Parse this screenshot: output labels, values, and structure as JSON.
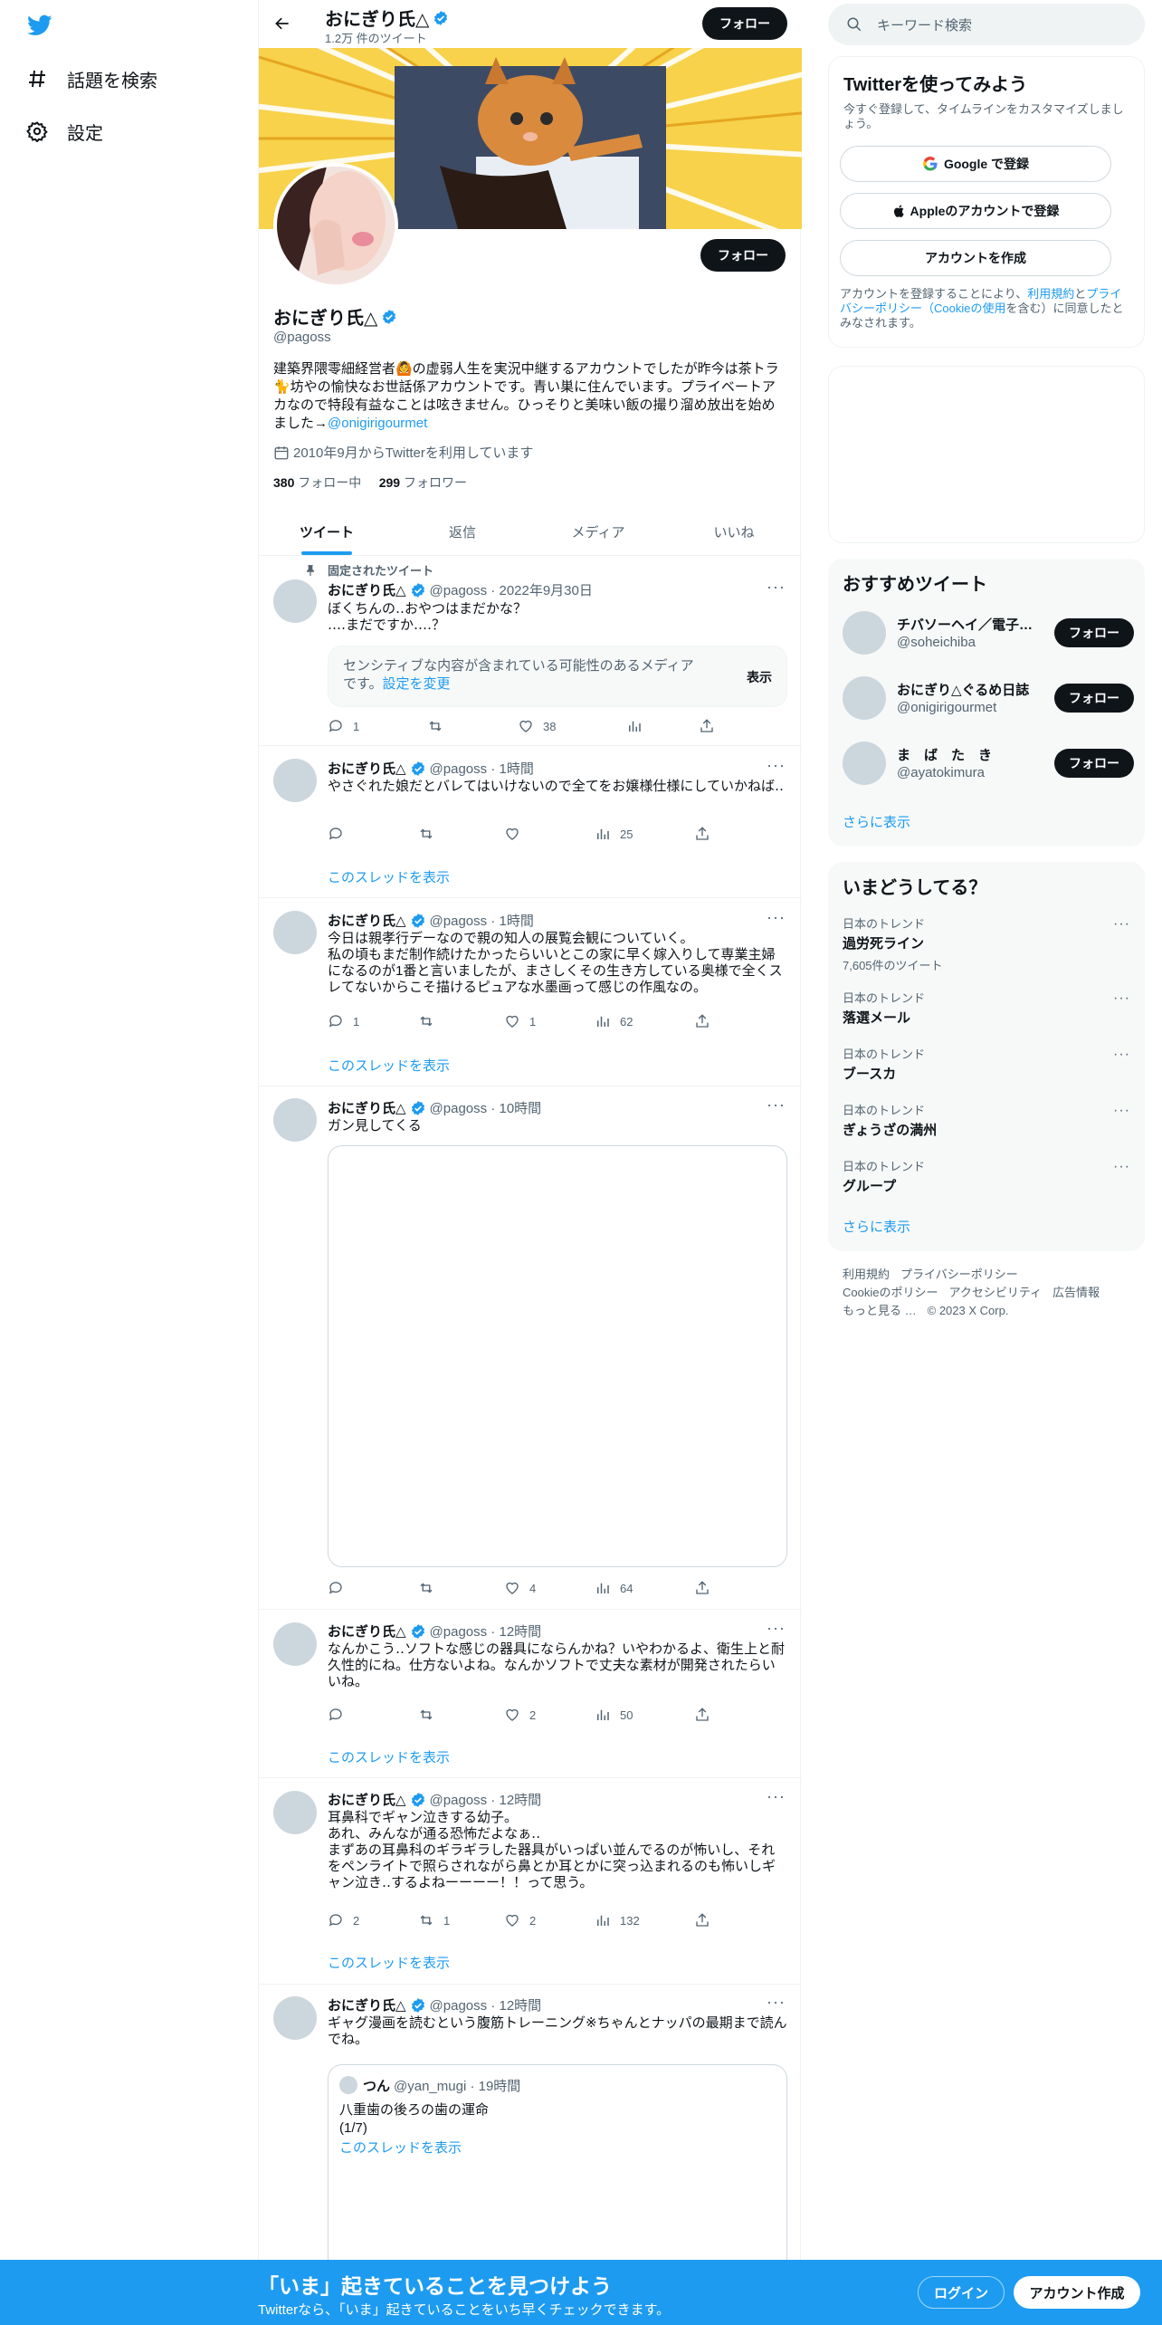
{
  "nav": {
    "explore_label": "話題を検索",
    "settings_label": "設定"
  },
  "header": {
    "name": "おにぎり氏△",
    "tweet_count": "1.2万 件のツイート",
    "follow_label": "フォロー"
  },
  "profile": {
    "name": "おにぎり氏△",
    "handle": "@pagoss",
    "bio": "建築界隈零細経営者🙆の虚弱人生を実況中継するアカウントでしたが昨今は茶トラ🐈坊やの愉快なお世話係アカウントです。青い巣に住んでいます。プライベートアカなので特段有益なことは呟きません。ひっそりと美味い飯の撮り溜め放出を始めました→",
    "bio_link": "@onigirigourmet",
    "joined": "2010年9月からTwitterを利用しています",
    "following_count": "380",
    "following_label": "フォロー中",
    "followers_count": "299",
    "followers_label": "フォロワー",
    "follow_label": "フォロー"
  },
  "tabs": [
    "ツイート",
    "返信",
    "メディア",
    "いいね"
  ],
  "pinned_label": "固定されたツイート",
  "thread_link_label": "このスレッドを表示",
  "tweets": [
    {
      "name": "おにぎり氏△",
      "meta": "@pagoss · 2022年9月30日",
      "text": "ぼくちんの‥おやつはまだかな？\n‥‥まだですか‥‥？",
      "sensitive_text": "センシティブな内容が含まれている可能性のあるメディアです。",
      "sensitive_link": "設定を変更",
      "sensitive_button": "表示",
      "replies": "1",
      "retweets": "",
      "likes": "38",
      "views": ""
    },
    {
      "name": "おにぎり氏△",
      "meta": "@pagoss · 1時間",
      "text": "やさぐれた娘だとバレてはいけないので全てをお嬢様仕様にしていかねば‥",
      "replies": "",
      "retweets": "",
      "likes": "",
      "views": "25"
    },
    {
      "name": "おにぎり氏△",
      "meta": "@pagoss · 1時間",
      "text": "今日は親孝行デーなので親の知人の展覧会観についていく。\n私の頃もまだ制作続けたかったらいいとこの家に早く嫁入りして専業主婦になるのが1番と言いましたが、まさしくその生き方している奥様で全くスレてないからこそ描けるピュアな水墨画って感じの作風なの。",
      "replies": "1",
      "retweets": "",
      "likes": "1",
      "views": "62"
    },
    {
      "name": "おにぎり氏△",
      "meta": "@pagoss · 10時間",
      "text": "ガン見してくる",
      "replies": "",
      "retweets": "",
      "likes": "4",
      "views": "64"
    },
    {
      "name": "おにぎり氏△",
      "meta": "@pagoss · 12時間",
      "text": "なんかこう‥ソフトな感じの器具にならんかね？いやわかるよ、衛生上と耐久性的にね。仕方ないよね。なんかソフトで丈夫な素材が開発されたらいいね。",
      "replies": "",
      "retweets": "",
      "likes": "2",
      "views": "50"
    },
    {
      "name": "おにぎり氏△",
      "meta": "@pagoss · 12時間",
      "text": "耳鼻科でギャン泣きする幼子。\nあれ、みんなが通る恐怖だよなぁ‥\nまずあの耳鼻科のギラギラした器具がいっぱい並んでるのが怖いし、それをペンライトで照らされながら鼻とか耳とかに突っ込まれるのも怖いしギャン泣き‥するよねーーーー！！って思う。",
      "replies": "2",
      "retweets": "1",
      "likes": "2",
      "views": "132"
    },
    {
      "name": "おにぎり氏△",
      "meta": "@pagoss · 12時間",
      "text": "ギャグ漫画を読むという腹筋トレーニング※ちゃんとナッパの最期まで読んでね。",
      "quote": {
        "name": "つん",
        "meta": "@yan_mugi · 19時間",
        "text": "八重歯の後ろの歯の運命\n(1/7)",
        "link": "このスレッドを表示"
      }
    }
  ],
  "search": {
    "placeholder": "キーワード検索"
  },
  "signup": {
    "title": "Twitterを使ってみよう",
    "subtitle": "今すぐ登録して、タイムラインをカスタマイズしましょう。",
    "google": "Google で登録",
    "apple": "Appleのアカウントで登録",
    "create": "アカウントを作成",
    "legal_prefix": "アカウントを登録することにより、",
    "legal_terms": "利用規約",
    "legal_and": "と",
    "legal_privacy": "プライバシーポリシー（Cookieの使用",
    "legal_suffix": "を含む）に同意したとみなされます。"
  },
  "recommend": {
    "title": "おすすめツイート",
    "items": [
      {
        "name": "チバソーヘイ／電子…",
        "handle": "@soheichiba",
        "follow": "フォロー"
      },
      {
        "name": "おにぎり△ぐるめ日誌",
        "handle": "@onigirigourmet",
        "follow": "フォロー"
      },
      {
        "name": "ま　ば　た　き",
        "handle": "@ayatokimura",
        "follow": "フォロー"
      }
    ],
    "more": "さらに表示"
  },
  "trends": {
    "title": "いまどうしてる？",
    "items": [
      {
        "category": "日本のトレンド",
        "name": "過労死ライン",
        "count": "7,605件のツイート"
      },
      {
        "category": "日本のトレンド",
        "name": "落選メール",
        "count": ""
      },
      {
        "category": "日本のトレンド",
        "name": "ブースカ",
        "count": ""
      },
      {
        "category": "日本のトレンド",
        "name": "ぎょうざの満州",
        "count": ""
      },
      {
        "category": "日本のトレンド",
        "name": "グループ",
        "count": ""
      }
    ],
    "more": "さらに表示"
  },
  "footer": {
    "terms": "利用規約",
    "privacy": "プライバシーポリシー",
    "cookie": "Cookieのポリシー",
    "accessibility": "アクセシビリティ",
    "ads": "広告情報",
    "more": "もっと見る …",
    "copyright": "© 2023 X Corp."
  },
  "bottom": {
    "title": "「いま」起きていることを見つけよう",
    "subtitle": "Twitterなら、「いま」起きていることをいち早くチェックできます。",
    "login": "ログイン",
    "signup": "アカウント作成"
  }
}
